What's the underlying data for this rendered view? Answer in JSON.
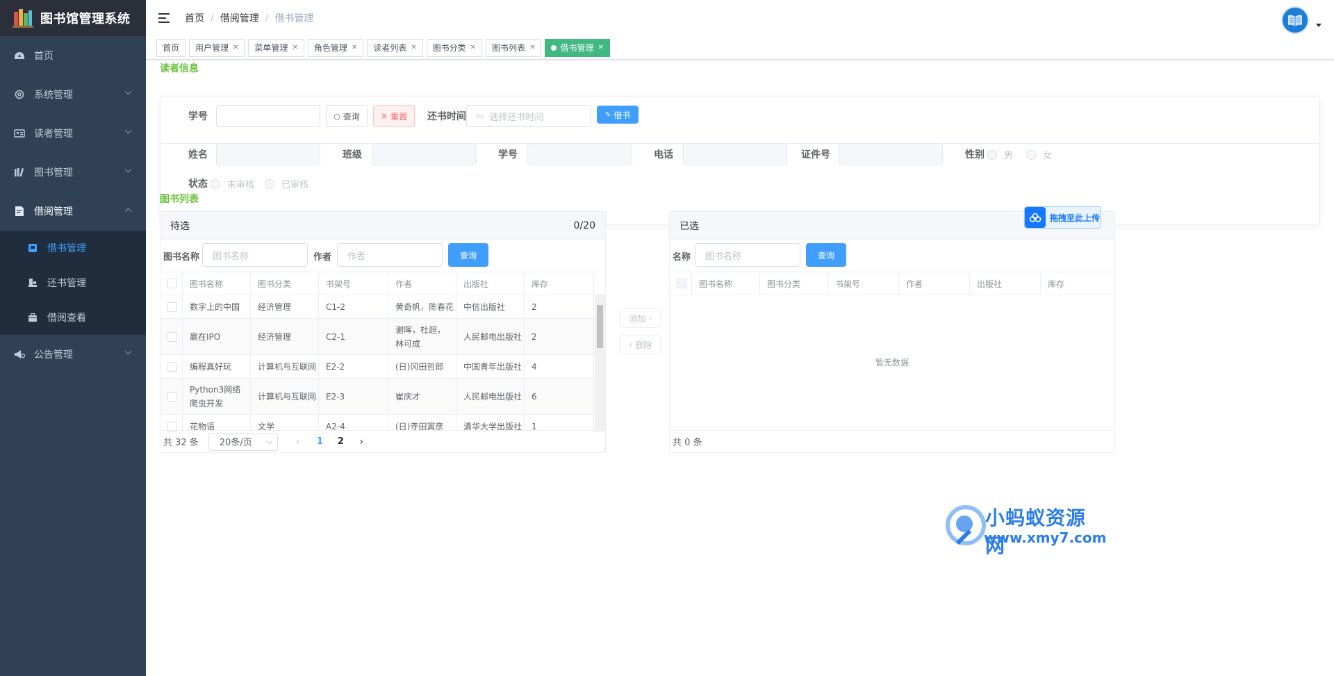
{
  "app": {
    "title": "图书馆管理系统"
  },
  "sidebar": {
    "items": [
      {
        "label": "首页",
        "icon": "dashboard-icon"
      },
      {
        "label": "系统管理",
        "icon": "gear-icon"
      },
      {
        "label": "读者管理",
        "icon": "id-card-icon"
      },
      {
        "label": "图书管理",
        "icon": "books-icon"
      },
      {
        "label": "借阅管理",
        "icon": "document-icon"
      },
      {
        "label": "公告管理",
        "icon": "announcement-icon"
      }
    ],
    "sub_items": [
      {
        "label": "借书管理",
        "icon": "book-icon"
      },
      {
        "label": "还书管理",
        "icon": "return-icon"
      },
      {
        "label": "借阅查看",
        "icon": "briefcase-icon"
      }
    ],
    "active_sub": "借书管理"
  },
  "breadcrumb": [
    "首页",
    "借阅管理",
    "借书管理"
  ],
  "tabs": [
    {
      "label": "首页",
      "closable": false
    },
    {
      "label": "用户管理",
      "closable": true
    },
    {
      "label": "菜单管理",
      "closable": true
    },
    {
      "label": "角色管理",
      "closable": true
    },
    {
      "label": "读者列表",
      "closable": true
    },
    {
      "label": "图书分类",
      "closable": true
    },
    {
      "label": "图书列表",
      "closable": true
    },
    {
      "label": "借书管理",
      "closable": true,
      "active": true
    }
  ],
  "reader": {
    "section_title": "读者信息",
    "student_id_label": "学号",
    "query_button": "查询",
    "reset_button": "重置",
    "return_time_label": "还书时间",
    "return_time_placeholder": "选择还书时间",
    "borrow_button": "借书",
    "fields": {
      "name": "姓名",
      "class": "班级",
      "student_id": "学号",
      "phone": "电话",
      "id_number": "证件号",
      "gender": "性别",
      "gender_male": "男",
      "gender_female": "女",
      "status": "状态",
      "status_unreviewed": "未审核",
      "status_reviewed": "已审核"
    }
  },
  "books": {
    "section_title": "图书列表",
    "left": {
      "title": "待选",
      "count": "0/20",
      "name_label": "图书名称",
      "name_placeholder": "图书名称",
      "author_label": "作者",
      "author_placeholder": "作者",
      "query_button": "查询",
      "columns": [
        "图书名称",
        "图书分类",
        "书架号",
        "作者",
        "出版社",
        "库存"
      ],
      "rows": [
        [
          "数字上的中国",
          "经济管理",
          "C1-2",
          "黄奇帆，陈春花",
          "中信出版社",
          "2"
        ],
        [
          "赢在IPO",
          "经济管理",
          "C2-1",
          "谢晖，杜超，林可成",
          "人民邮电出版社",
          "2"
        ],
        [
          "编程真好玩",
          "计算机与互联网",
          "E2-2",
          "(日)冈田哲郎",
          "中国青年出版社",
          "4"
        ],
        [
          "Python3网络爬虫开发",
          "计算机与互联网",
          "E2-3",
          "崔庆才",
          "人民邮电出版社",
          "6"
        ],
        [
          "花物语",
          "文学",
          "A2-4",
          "(日)寺田寅彦",
          "清华大学出版社",
          "1"
        ]
      ],
      "total": "共 32 条",
      "page_size": "20条/页",
      "pages": [
        "1",
        "2"
      ],
      "current_page": "1"
    },
    "add_button": "添加",
    "remove_button": "删除",
    "right": {
      "title": "已选",
      "name_label": "名称",
      "name_placeholder": "图书名称",
      "query_button": "查询",
      "columns": [
        "图书名称",
        "图书分类",
        "书架号",
        "作者",
        "出版社",
        "库存"
      ],
      "empty": "暂无数据",
      "total": "共 0 条"
    }
  },
  "float_upload": "拖拽至此上传",
  "watermark": {
    "title": "小蚂蚁资源网",
    "url": "www.xmy7.com"
  },
  "colors": {
    "sidebar": "#304156",
    "accent": "#409eff",
    "active_tag": "#42b983",
    "section_title": "#67c23a"
  }
}
